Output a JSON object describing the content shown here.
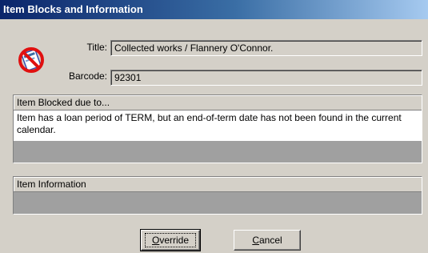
{
  "window": {
    "title": "Item Blocks and Information"
  },
  "icon": {
    "name": "blocked-item-icon"
  },
  "fields": {
    "title_label": "Title:",
    "title_value": "Collected works / Flannery O'Connor.",
    "barcode_label": "Barcode:",
    "barcode_value": "92301"
  },
  "blocked": {
    "header": "Item Blocked due to...",
    "message": "Item has a loan period of TERM, but an end-of-term date has not been found in the current calendar."
  },
  "info": {
    "header": "Item Information"
  },
  "buttons": {
    "override": {
      "accel": "O",
      "rest": "verride"
    },
    "cancel": {
      "accel": "C",
      "rest": "ancel"
    }
  }
}
